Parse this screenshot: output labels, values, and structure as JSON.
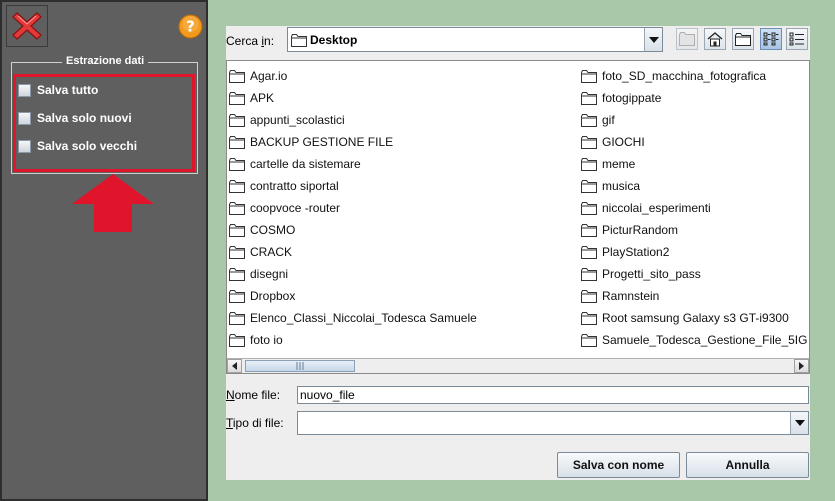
{
  "left": {
    "group_title": "Estrazione dati",
    "options": [
      {
        "label": "Salva tutto",
        "checked": false
      },
      {
        "label": "Salva solo nuovi",
        "checked": false
      },
      {
        "label": "Salva solo vecchi",
        "checked": false
      }
    ],
    "highlight_color": "#e0142a"
  },
  "chooser": {
    "look_in_label_prefix": "Cerca ",
    "look_in_label_mnemonic": "i",
    "look_in_label_suffix": "n:",
    "look_in_value": "Desktop",
    "files_col1": [
      "Agar.io",
      "APK",
      "appunti_scolastici",
      "BACKUP GESTIONE FILE",
      "cartelle da sistemare",
      "contratto siportal",
      "coopvoce -router",
      "COSMO",
      "CRACK",
      "disegni",
      "Dropbox",
      "Elenco_Classi_Niccolai_Todesca Samuele",
      "foto io"
    ],
    "files_col2": [
      "foto_SD_macchina_fotografica",
      "fotogippate",
      "gif",
      "GIOCHI",
      "meme",
      "musica",
      "niccolai_esperimenti",
      "PicturRandom",
      "PlayStation2",
      "Progetti_sito_pass",
      "Ramnstein",
      "Root samsung Galaxy s3 GT-i9300",
      "Samuele_Todesca_Gestione_File_5IG"
    ],
    "file_name_label_mnemonic": "N",
    "file_name_label_rest": "ome file:",
    "file_name_value": "nuovo_file",
    "file_type_label_mnemonic": "T",
    "file_type_label_rest": "ipo di file:",
    "file_type_value": "",
    "save_button": "Salva con nome",
    "cancel_button": "Annulla"
  },
  "icons": {
    "close": "close-icon",
    "help": "help-icon",
    "folder": "folder-icon",
    "up_folder": "up-folder-icon",
    "home": "home-icon",
    "new_folder": "new-folder-icon",
    "list_view": "list-view-icon",
    "details_view": "details-view-icon"
  },
  "colors": {
    "left_panel_bg": "#5f5f5f",
    "window_bg": "#a9c8a9",
    "chooser_bg": "#eeeeee"
  }
}
